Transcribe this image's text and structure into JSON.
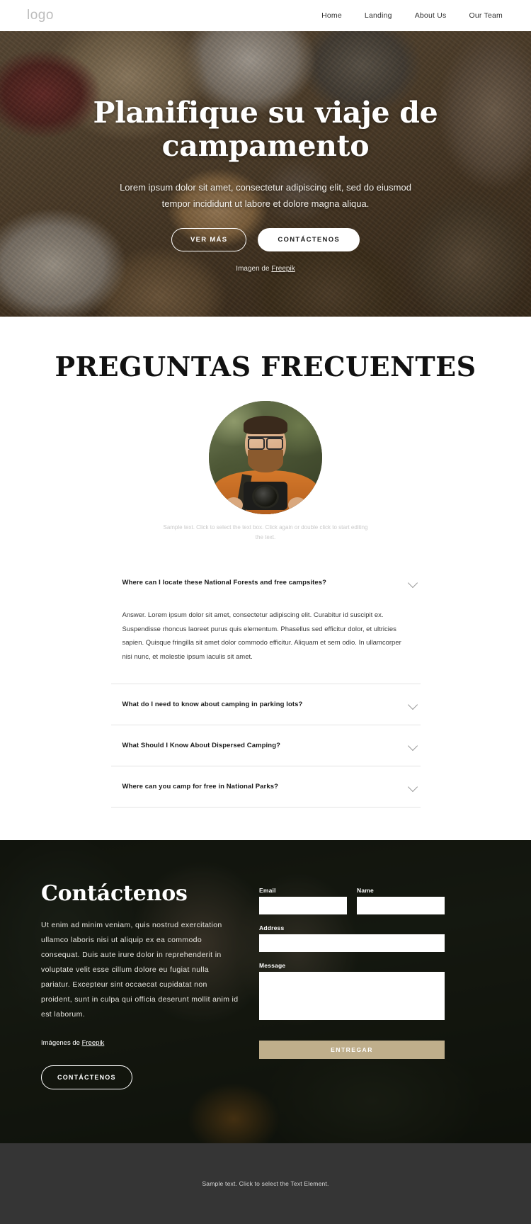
{
  "header": {
    "logo": "logo",
    "nav": [
      {
        "label": "Home"
      },
      {
        "label": "Landing"
      },
      {
        "label": "About Us"
      },
      {
        "label": "Our Team"
      }
    ]
  },
  "hero": {
    "title": "Planifique su viaje de campamento",
    "subtitle": "Lorem ipsum dolor sit amet, consectetur adipiscing elit, sed do eiusmod tempor incididunt ut labore et dolore magna aliqua.",
    "primary_button": "VER MÁS",
    "secondary_button": "CONTÁCTENOS",
    "credit_prefix": "Imagen de ",
    "credit_link": "Freepik"
  },
  "faq": {
    "title": "PREGUNTAS FRECUENTES",
    "avatar_caption": "Sample text. Click to select the text box. Click again or double click to start editing the text.",
    "items": [
      {
        "question": "Where can I locate these National Forests and free campsites?",
        "answer": "Answer. Lorem ipsum dolor sit amet, consectetur adipiscing elit. Curabitur id suscipit ex. Suspendisse rhoncus laoreet purus quis elementum. Phasellus sed efficitur dolor, et ultricies sapien. Quisque fringilla sit amet dolor commodo efficitur. Aliquam et sem odio. In ullamcorper nisi nunc, et molestie ipsum iaculis sit amet.",
        "expanded": true
      },
      {
        "question": "What do I need to know about camping in parking lots?",
        "expanded": false
      },
      {
        "question": "What Should I Know About Dispersed Camping?",
        "expanded": false
      },
      {
        "question": "Where can you camp for free in National Parks?",
        "expanded": false
      }
    ]
  },
  "contact": {
    "title": "Contáctenos",
    "body": "Ut enim ad minim veniam, quis nostrud exercitation ullamco laboris nisi ut aliquip ex ea commodo consequat. Duis aute irure dolor in reprehenderit in voluptate velit esse cillum dolore eu fugiat nulla pariatur. Excepteur sint occaecat cupidatat non proident, sunt in culpa qui officia deserunt mollit anim id est laborum.",
    "credit_prefix": "Imágenes de ",
    "credit_link": "Freepik",
    "button": "CONTÁCTENOS",
    "form": {
      "email_label": "Email",
      "email_value": "",
      "name_label": "Name",
      "name_value": "",
      "address_label": "Address",
      "address_value": "",
      "message_label": "Message",
      "message_value": "",
      "submit_label": "ENTREGAR"
    }
  },
  "footer": {
    "text": "Sample text. Click to select the Text Element."
  },
  "colors": {
    "accent": "#bfae8b",
    "footer_bg": "#353535",
    "body_text": "#3a3a3a"
  }
}
